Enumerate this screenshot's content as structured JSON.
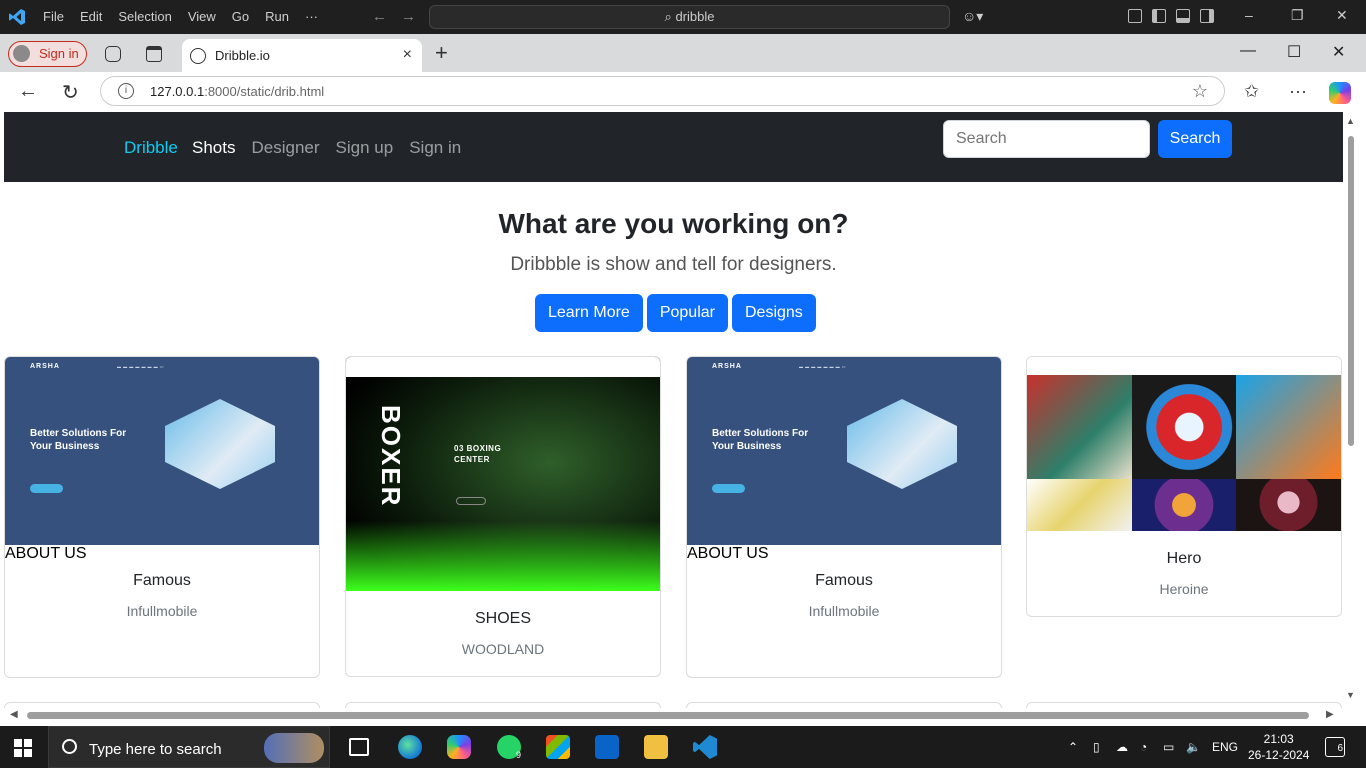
{
  "vscode": {
    "menu": [
      "File",
      "Edit",
      "Selection",
      "View",
      "Go",
      "Run",
      "···"
    ],
    "command_center": "dribble"
  },
  "browser": {
    "profile_label": "Sign in",
    "tab_title": "Dribble.io",
    "url_host": "127.0.0.1",
    "url_rest": ":8000/static/drib.html"
  },
  "page": {
    "navbar": {
      "brand": "Dribble",
      "links": [
        "Shots",
        "Designer",
        "Sign up",
        "Sign in"
      ],
      "search_placeholder": "Search",
      "search_button": "Search"
    },
    "hero": {
      "title": "What are you working on?",
      "subtitle": "Dribbble is show and tell for designers.",
      "buttons": [
        "Learn More",
        "Popular",
        "Designs"
      ]
    },
    "cards": [
      {
        "title": "Famous",
        "subtitle": "Infullmobile",
        "image_brand": "ARSHA",
        "image_headline": "Better Solutions For Your Business",
        "image_section": "ABOUT US"
      },
      {
        "title": "SHOES",
        "subtitle": "WOODLAND",
        "image_brand": "BOXER",
        "image_headline": "03 BOXING CENTER"
      },
      {
        "title": "Famous",
        "subtitle": "Infullmobile",
        "image_brand": "ARSHA",
        "image_headline": "Better Solutions For Your Business",
        "image_section": "ABOUT US"
      },
      {
        "title": "Hero",
        "subtitle": "Heroine"
      }
    ]
  },
  "taskbar": {
    "search_placeholder": "Type here to search",
    "whatsapp_badge": "9",
    "language": "ENG",
    "time": "21:03",
    "date": "26-12-2024",
    "notifications": "6"
  },
  "colors": {
    "navbar_bg": "#212529",
    "primary": "#0d6efd",
    "brand": "#0dcaf0",
    "arsha_bg": "#37517e",
    "boxer_green": "#3dff1c"
  }
}
